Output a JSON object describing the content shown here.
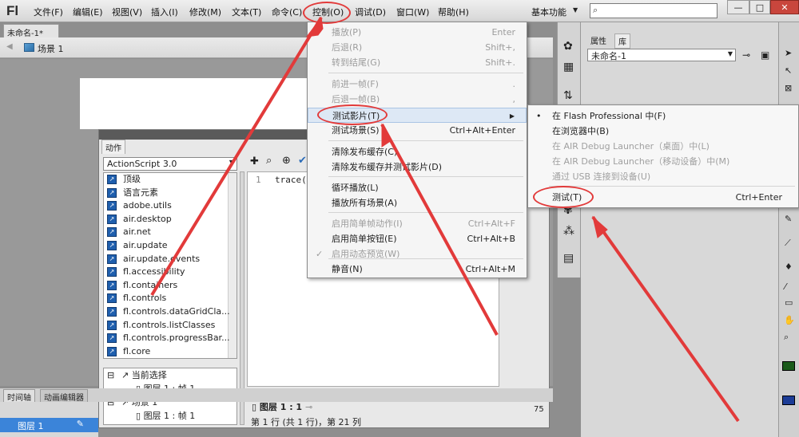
{
  "app": {
    "logo": "Fl"
  },
  "menubar": {
    "items": [
      "文件(F)",
      "编辑(E)",
      "视图(V)",
      "插入(I)",
      "修改(M)",
      "文本(T)",
      "命令(C)",
      "控制(O)",
      "调试(D)",
      "窗口(W)",
      "帮助(H)"
    ],
    "workspace": "基本功能",
    "window_buttons": [
      "—",
      "□",
      "✕"
    ]
  },
  "document": {
    "tab": "未命名-1*",
    "scene": "场景 1"
  },
  "actions_panel": {
    "tab": "动作",
    "language": "ActionScript 3.0",
    "packages": [
      "顶级",
      "语言元素",
      "adobe.utils",
      "air.desktop",
      "air.net",
      "air.update",
      "air.update.events",
      "fl.accessibility",
      "fl.containers",
      "fl.controls",
      "fl.controls.dataGridCla...",
      "fl.controls.listClasses",
      "fl.controls.progressBar...",
      "fl.core"
    ],
    "tree": [
      {
        "label": "当前选择",
        "level": 0
      },
      {
        "label": "图层 1 : 帧 1",
        "level": 1
      },
      {
        "label": "场景 1",
        "level": 0
      },
      {
        "label": "图层 1 : 帧 1",
        "level": 1
      }
    ],
    "code_line_no": "1",
    "code_text": "trace(\"",
    "bottom_tab": "图层 1 : 1",
    "status": "第 1 行 (共 1 行)，第 21 列"
  },
  "timeline": {
    "tabs": [
      "时间轴",
      "动画编辑器"
    ],
    "layer": "图层 1",
    "frame_marker": "75"
  },
  "props_panel": {
    "tabs": [
      "属性",
      "库"
    ],
    "library_select": "未命名-1"
  },
  "control_menu": {
    "items": [
      {
        "label": "播放(P)",
        "shortcut": "Enter",
        "disabled": true
      },
      {
        "label": "后退(R)",
        "shortcut": "Shift+,",
        "disabled": true
      },
      {
        "label": "转到结尾(G)",
        "shortcut": "Shift+.",
        "disabled": true
      },
      {
        "label": "前进一帧(F)",
        "shortcut": ".",
        "disabled": true
      },
      {
        "label": "后退一帧(B)",
        "shortcut": ",",
        "disabled": true
      },
      {
        "label": "测试影片(T)",
        "shortcut": "",
        "disabled": false
      },
      {
        "label": "测试场景(S)",
        "shortcut": "Ctrl+Alt+Enter",
        "disabled": false
      },
      {
        "label": "清除发布缓存(C)",
        "shortcut": "",
        "disabled": false
      },
      {
        "label": "清除发布缓存并测试影片(D)",
        "shortcut": "",
        "disabled": false
      },
      {
        "label": "循环播放(L)",
        "shortcut": "",
        "disabled": false
      },
      {
        "label": "播放所有场景(A)",
        "shortcut": "",
        "disabled": false
      },
      {
        "label": "启用简单帧动作(I)",
        "shortcut": "Ctrl+Alt+F",
        "disabled": true
      },
      {
        "label": "启用简单按钮(E)",
        "shortcut": "Ctrl+Alt+B",
        "disabled": false
      },
      {
        "label": "启用动态预览(W)",
        "shortcut": "",
        "disabled": true
      },
      {
        "label": "静音(N)",
        "shortcut": "Ctrl+Alt+M",
        "disabled": false
      }
    ],
    "submenu_arrow": "▶",
    "check_mark": "✓"
  },
  "test_movie_submenu": {
    "items": [
      {
        "label": "在 Flash Professional 中(F)",
        "shortcut": "",
        "disabled": false
      },
      {
        "label": "在浏览器中(B)",
        "shortcut": "",
        "disabled": false
      },
      {
        "label": "在 AIR Debug Launcher（桌面）中(L)",
        "shortcut": "",
        "disabled": true
      },
      {
        "label": "在 AIR Debug Launcher（移动设备）中(M)",
        "shortcut": "",
        "disabled": true
      },
      {
        "label": "通过 USB 连接到设备(U)",
        "shortcut": "",
        "disabled": true
      },
      {
        "label": "测试(T)",
        "shortcut": "Ctrl+Enter",
        "disabled": false
      }
    ],
    "bullet": "•"
  },
  "colors": {
    "annotation": "#e23a3a",
    "selected_layer": "#3b84d9",
    "package_icon": "#1f5fae"
  }
}
